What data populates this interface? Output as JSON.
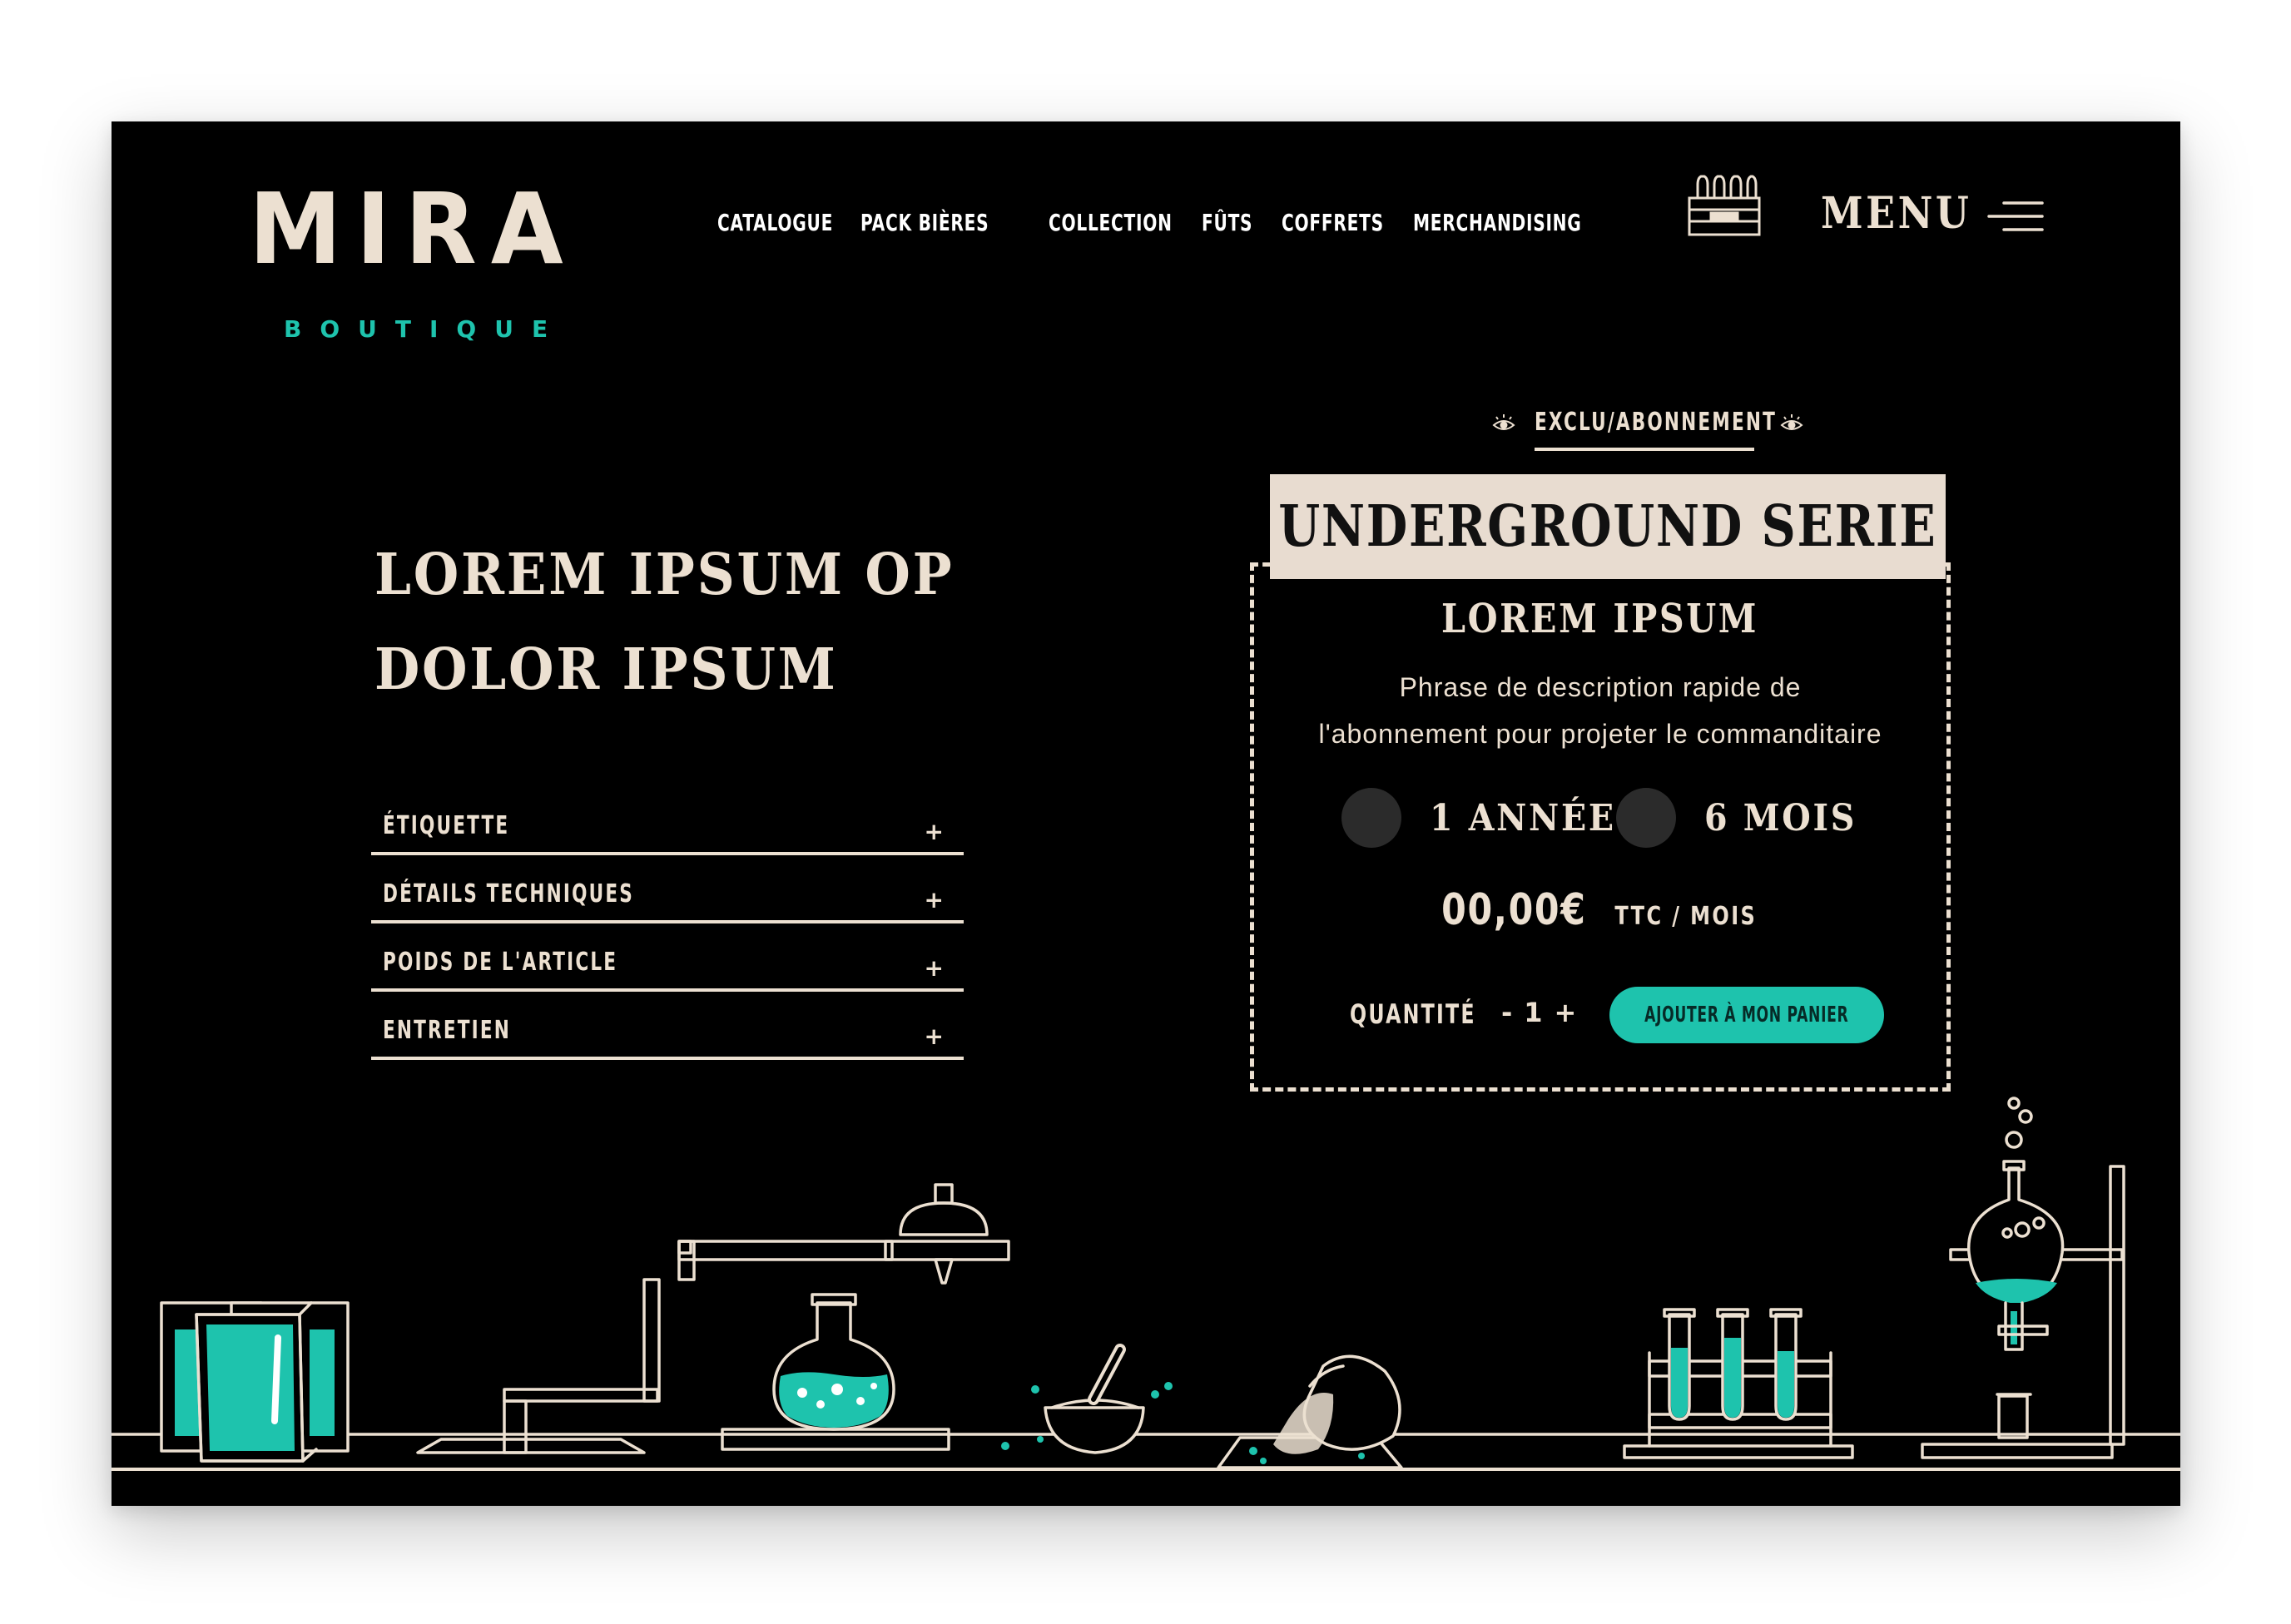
{
  "brand": {
    "name": "MIRA",
    "sub": "BOUTIQUE",
    "accent": "#1ec3ad",
    "cream": "#ece0d1",
    "background": "#000000"
  },
  "nav": {
    "items": [
      "CATALOGUE",
      "PACK BIÈRES",
      "COLLECTION",
      "FÛTS",
      "COFFRETS",
      "MERCHANDISING"
    ]
  },
  "header": {
    "menu_label": "MENU",
    "crate_icon": "beer-crate-icon",
    "menu_icon": "hamburger-icon"
  },
  "hero": {
    "title_line1": "LOREM IPSUM OP",
    "title_line2": "DOLOR IPSUM"
  },
  "accordion": {
    "items": [
      {
        "label": "ÉTIQUETTE",
        "toggle": "+"
      },
      {
        "label": "DÉTAILS TECHNIQUES",
        "toggle": "+"
      },
      {
        "label": "POIDS DE L'ARTICLE",
        "toggle": "+"
      },
      {
        "label": "ENTRETIEN",
        "toggle": "+"
      }
    ]
  },
  "product": {
    "tag": "EXCLU/ABONNEMENT",
    "ribbon": "UNDERGROUND SERIE",
    "title": "LOREM IPSUM",
    "description_line1": "Phrase de description rapide de",
    "description_line2": "l'abonnement pour projeter le commanditaire",
    "options": [
      {
        "label": "1 ANNÉE"
      },
      {
        "label": "6 MOIS"
      }
    ],
    "price": "00,00€",
    "price_unit": "TTC / MOIS",
    "quantity_label": "QUANTITÉ",
    "quantity": {
      "minus": "-",
      "value": "1",
      "plus": "+"
    },
    "cta_label": "AJOUTER À MON PANIER"
  },
  "illustration": {
    "items": [
      "beer-cans-icon",
      "distillation-stand-icon",
      "round-flask-icon",
      "mortar-pestle-icon",
      "grain-sack-icon",
      "test-tubes-icon",
      "retort-stand-icon"
    ]
  }
}
